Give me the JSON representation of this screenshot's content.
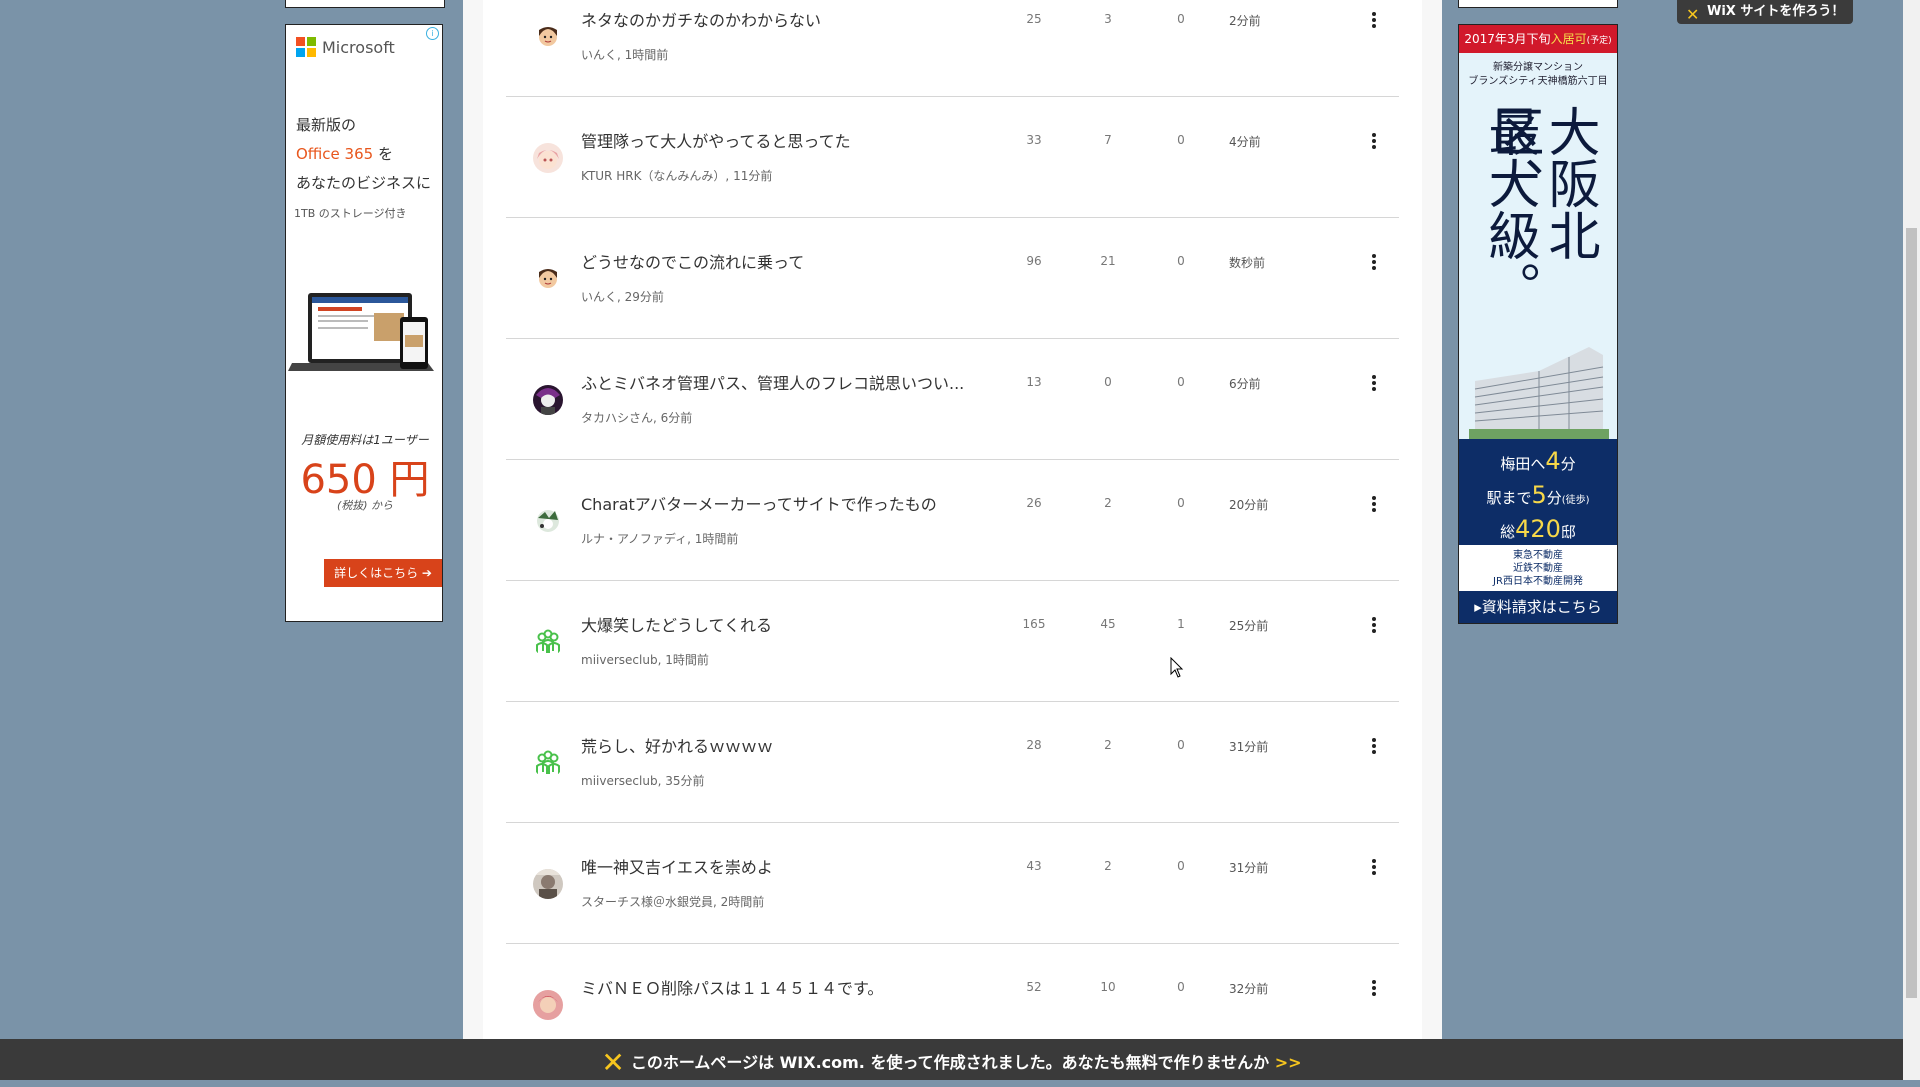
{
  "ad_left": {
    "brand": "Microsoft",
    "line1": "最新版の",
    "line2_product": "Office 365",
    "line2_rest": " を",
    "line3": "あなたのビジネスに",
    "storage": "1TB のストレージ付き",
    "price_note": "月額使用料は1ユーザー",
    "price": "650 円",
    "price_sub": "(税抜) から",
    "cta": "詳しくはこちら ➔"
  },
  "posts": [
    {
      "title": "ネタなのかガチなのかわからない",
      "author": "いんく, 1時間前",
      "c1": "25",
      "c2": "3",
      "c3": "0",
      "time": "2分前",
      "avatar": "face-a"
    },
    {
      "title": "管理隊って大人がやってると思ってた",
      "author": "KTUR HRK（なんみんみ）, 11分前",
      "c1": "33",
      "c2": "7",
      "c3": "0",
      "time": "4分前",
      "avatar": "anime-pink"
    },
    {
      "title": "どうせなのでこの流れに乗って",
      "author": "いんく, 29分前",
      "c1": "96",
      "c2": "21",
      "c3": "0",
      "time": "数秒前",
      "avatar": "face-a"
    },
    {
      "title": "ふとミバネオ管理パス、管理人のフレコ説思いつい...",
      "author": "タカハシさん, 6分前",
      "c1": "13",
      "c2": "0",
      "c3": "0",
      "time": "6分前",
      "avatar": "dark-purple"
    },
    {
      "title": "Charatアバターメーカーってサイトで作ったもの",
      "author": "ルナ・アノファディ, 1時間前",
      "c1": "26",
      "c2": "2",
      "c3": "0",
      "time": "20分前",
      "avatar": "green-white"
    },
    {
      "title": "大爆笑したどうしてくれる",
      "author": "miiverseclub, 1時間前",
      "c1": "165",
      "c2": "45",
      "c3": "1",
      "time": "25分前",
      "avatar": "group"
    },
    {
      "title": "荒らし、好かれるｗｗｗｗ",
      "author": "miiverseclub, 35分前",
      "c1": "28",
      "c2": "2",
      "c3": "0",
      "time": "31分前",
      "avatar": "group"
    },
    {
      "title": "唯一神又吉イエスを崇めよ",
      "author": "スターチス様＠水銀党員, 2時間前",
      "c1": "43",
      "c2": "2",
      "c3": "0",
      "time": "31分前",
      "avatar": "photo"
    },
    {
      "title": "ミバＮＥＯ削除パスは１１４５１４です。",
      "author": "",
      "c1": "52",
      "c2": "10",
      "c3": "0",
      "time": "32分前",
      "avatar": "red-face"
    }
  ],
  "ad_right": {
    "top_year": "2017年3月下旬",
    "top_move": "入居可",
    "top_note": "(予定)",
    "sub1": "新築分譲マンション",
    "sub2": "ブランズシティ天神橋筋六丁目",
    "big_col1": "大阪北区、",
    "big_col2": "最大級。",
    "line_umeda_pre": "梅田へ",
    "line_umeda_num": "4",
    "line_umeda_post": "分",
    "line_station_pre": "駅まで",
    "line_station_num": "5",
    "line_station_post": "分",
    "line_station_note": "(徒歩)",
    "line_total_pre": "総",
    "line_total_num": "420",
    "line_total_post": "邸",
    "logo1": "東急不動産",
    "logo2": "近鉄不動産",
    "logo3": "JR西日本不動産開発",
    "cta": "▸資料請求はこちら"
  },
  "wix_badge": "WiX サイトを作ろう！",
  "wix_banner": {
    "text": "このホームページは WIX.com. を使って作成されました。あなたも無料で作りませんか",
    "arrow": ">>"
  },
  "colors": {
    "page_bg": "#7a93a8",
    "ms_red": "#f25022",
    "ms_green": "#7fba00",
    "ms_blue": "#00a4ef",
    "ms_yellow": "#ffb900",
    "office_orange": "#d8431a",
    "ad_navy": "#0d2d67"
  }
}
